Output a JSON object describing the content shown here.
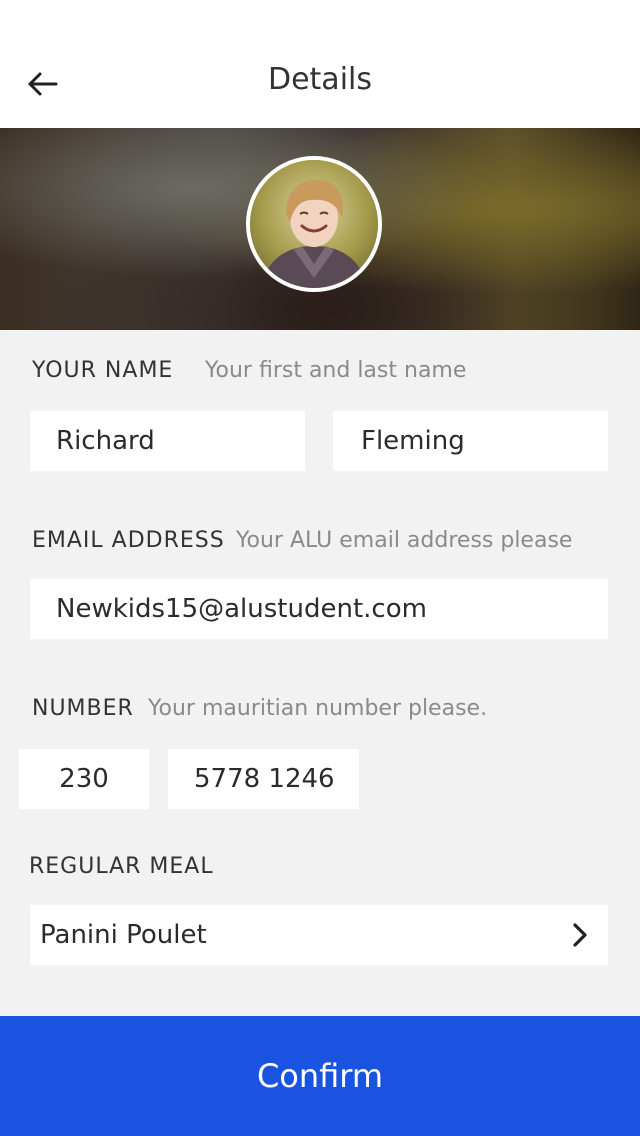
{
  "header": {
    "title": "Details",
    "back_icon": "arrow-left-icon"
  },
  "profile": {
    "avatar_icon": "user-photo"
  },
  "name_section": {
    "label": "YOUR NAME",
    "hint": "Your first and last name",
    "first_name": "Richard",
    "last_name": "Fleming"
  },
  "email_section": {
    "label": "EMAIL ADDRESS",
    "hint": "Your ALU email address please",
    "value": "Newkids15@alustudent.com"
  },
  "number_section": {
    "label": "NUMBER",
    "hint": "Your mauritian number please.",
    "country_code": "230",
    "phone": "5778 1246"
  },
  "meal_section": {
    "label": "REGULAR MEAL",
    "value": "Panini Poulet",
    "chevron_icon": "chevron-right-icon"
  },
  "confirm": {
    "label": "Confirm",
    "color": "#1a53e0"
  }
}
